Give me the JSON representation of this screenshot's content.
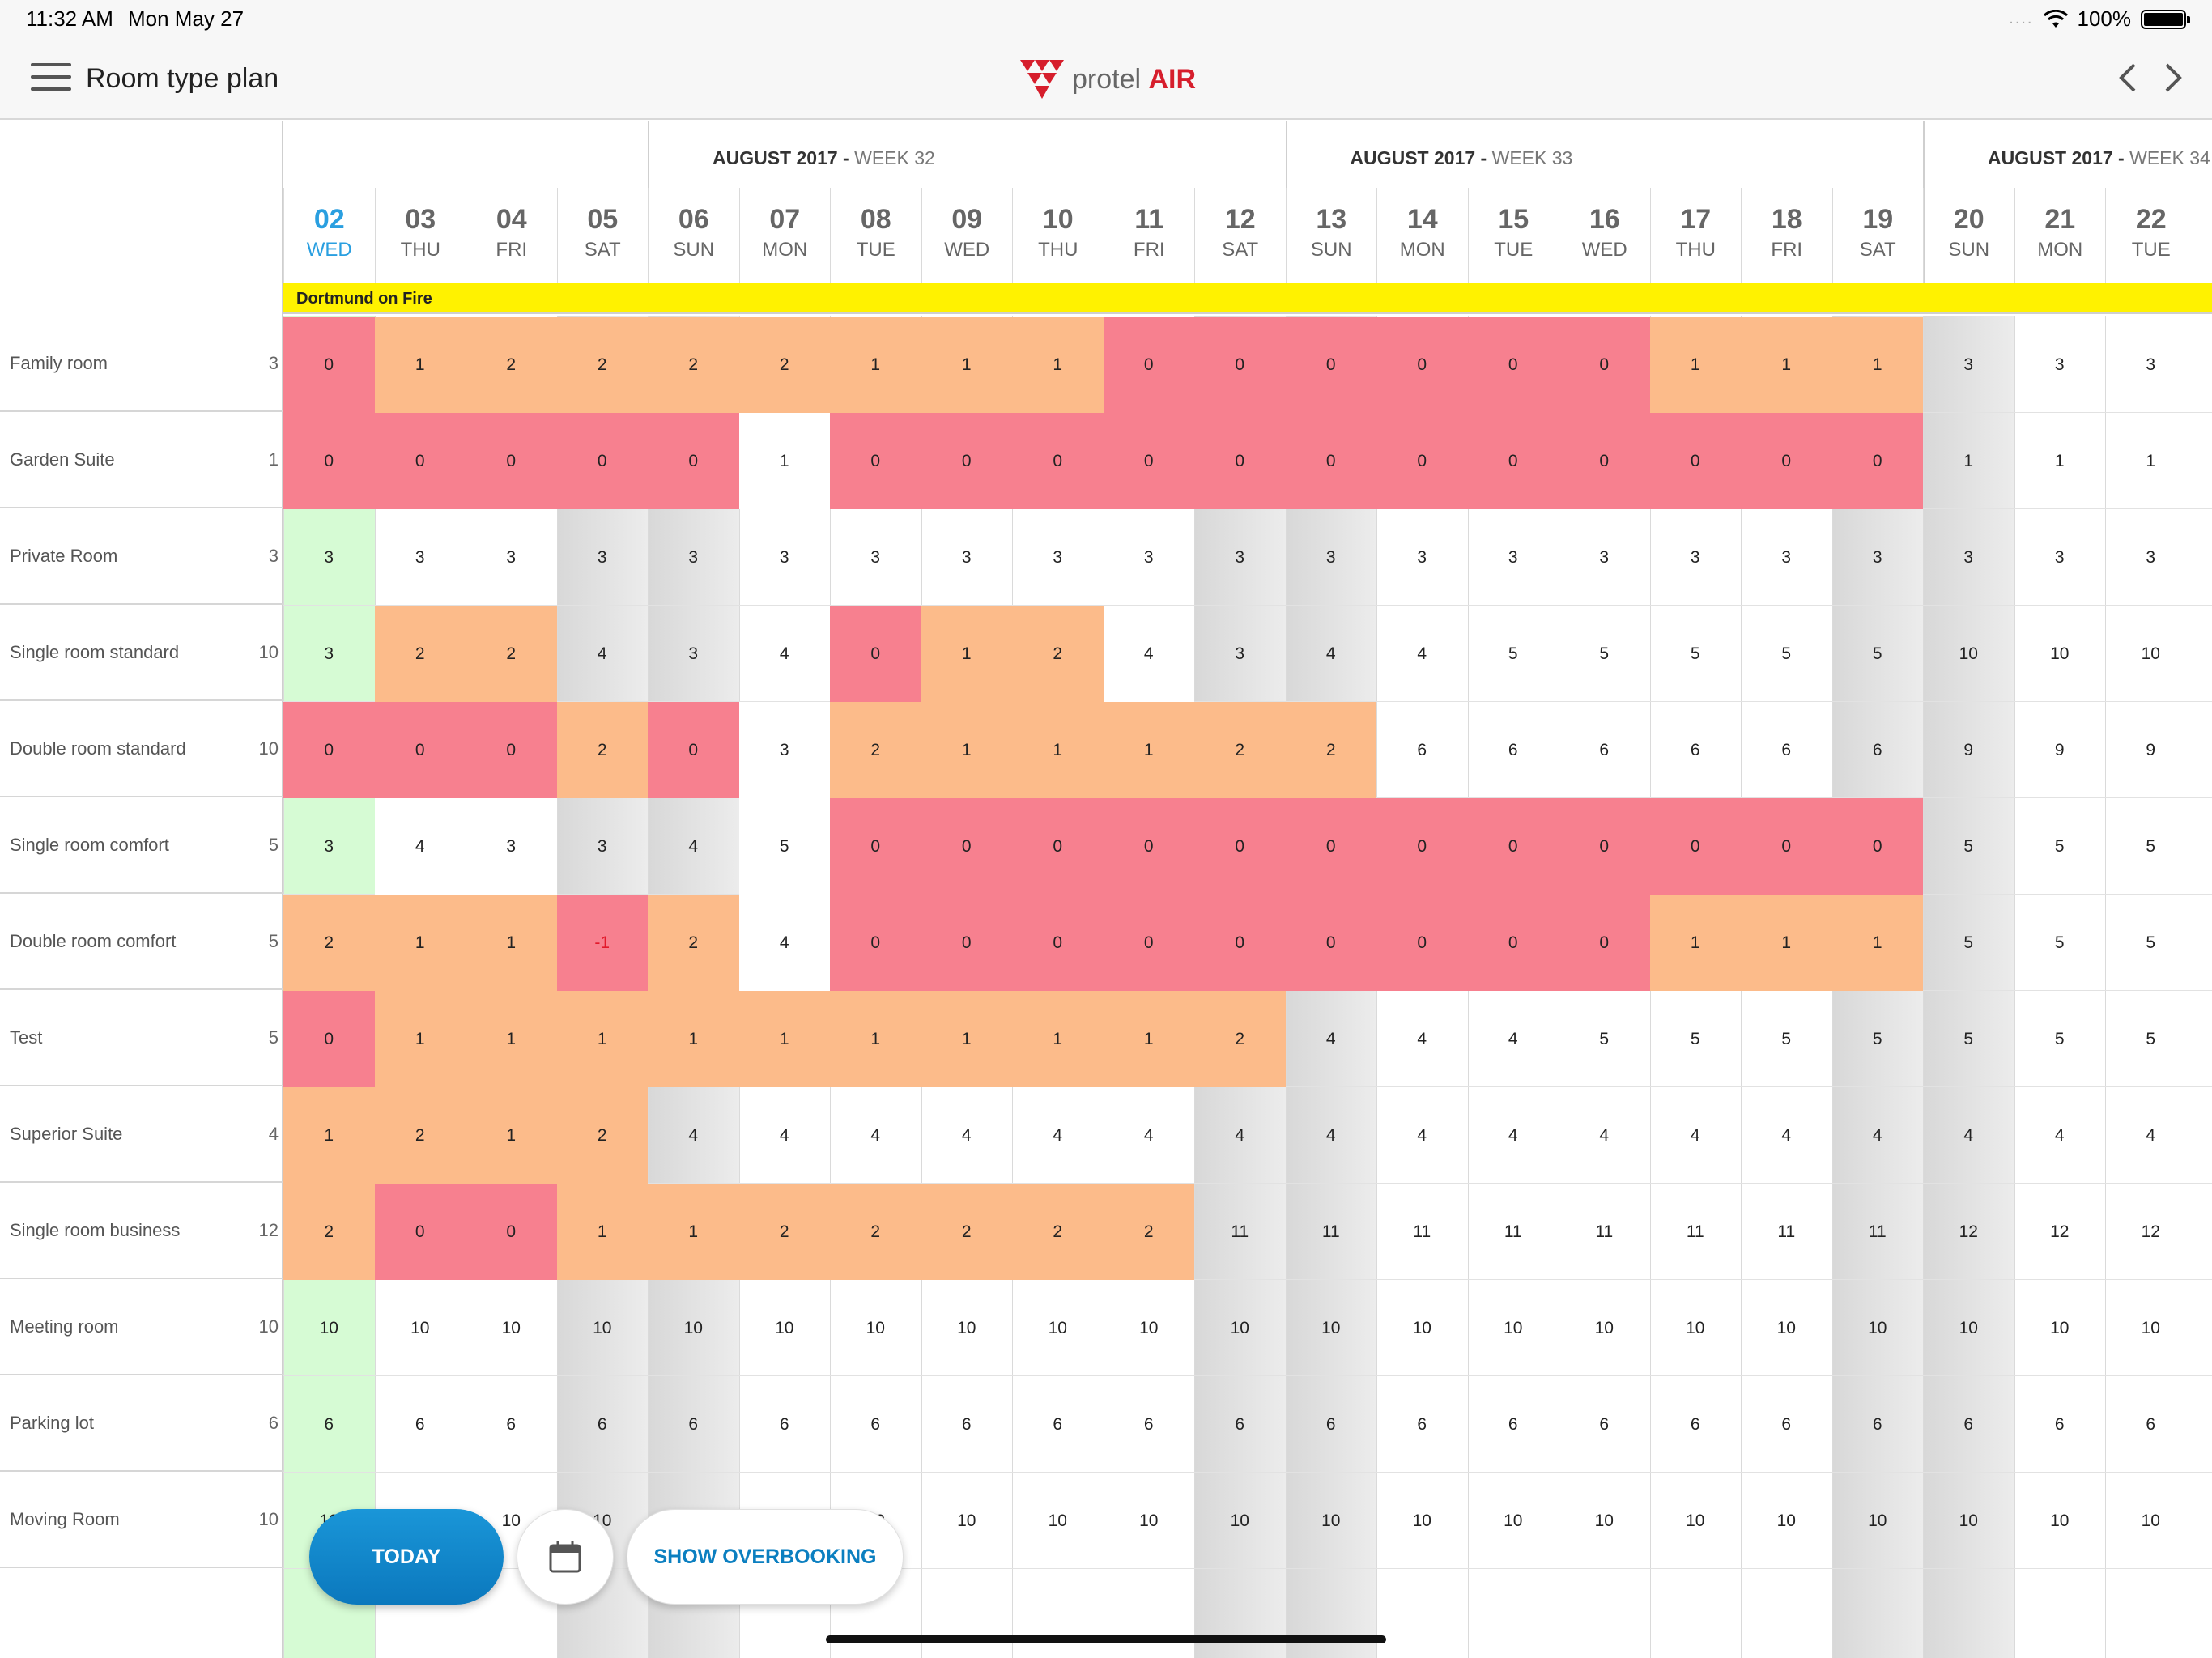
{
  "status_bar": {
    "time": "11:32 AM",
    "date": "Mon May 27",
    "dots": "....",
    "battery": "100%"
  },
  "header": {
    "title": "Room type plan",
    "brand_main": "protel ",
    "brand_accent": "AIR"
  },
  "weeks": [
    {
      "label": "AUGUST 2017 - ",
      "week": "WEEK 32"
    },
    {
      "label": "AUGUST 2017 - ",
      "week": "WEEK 33"
    },
    {
      "label": "AUGUST 2017 - ",
      "week": "WEEK 34"
    }
  ],
  "days": [
    {
      "num": "02",
      "dow": "WED"
    },
    {
      "num": "03",
      "dow": "THU"
    },
    {
      "num": "04",
      "dow": "FRI"
    },
    {
      "num": "05",
      "dow": "SAT"
    },
    {
      "num": "06",
      "dow": "SUN"
    },
    {
      "num": "07",
      "dow": "MON"
    },
    {
      "num": "08",
      "dow": "TUE"
    },
    {
      "num": "09",
      "dow": "WED"
    },
    {
      "num": "10",
      "dow": "THU"
    },
    {
      "num": "11",
      "dow": "FRI"
    },
    {
      "num": "12",
      "dow": "SAT"
    },
    {
      "num": "13",
      "dow": "SUN"
    },
    {
      "num": "14",
      "dow": "MON"
    },
    {
      "num": "15",
      "dow": "TUE"
    },
    {
      "num": "16",
      "dow": "WED"
    },
    {
      "num": "17",
      "dow": "THU"
    },
    {
      "num": "18",
      "dow": "FRI"
    },
    {
      "num": "19",
      "dow": "SAT"
    },
    {
      "num": "20",
      "dow": "SUN"
    },
    {
      "num": "21",
      "dow": "MON"
    },
    {
      "num": "22",
      "dow": "TUE"
    }
  ],
  "event": "Dortmund on Fire",
  "rooms": [
    {
      "name": "Family room",
      "count": "3",
      "values": [
        "0",
        "1",
        "2",
        "2",
        "2",
        "2",
        "1",
        "1",
        "1",
        "0",
        "0",
        "0",
        "0",
        "0",
        "0",
        "1",
        "1",
        "1",
        "3",
        "3",
        "3"
      ],
      "status": [
        "r",
        "o",
        "o",
        "o",
        "o",
        "o",
        "o",
        "o",
        "o",
        "r",
        "r",
        "r",
        "r",
        "r",
        "r",
        "o",
        "o",
        "o",
        "",
        "",
        ""
      ]
    },
    {
      "name": "Garden Suite",
      "count": "1",
      "values": [
        "0",
        "0",
        "0",
        "0",
        "0",
        "1",
        "0",
        "0",
        "0",
        "0",
        "0",
        "0",
        "0",
        "0",
        "0",
        "0",
        "0",
        "0",
        "1",
        "1",
        "1"
      ],
      "status": [
        "r",
        "r",
        "r",
        "r",
        "r",
        "w",
        "r",
        "r",
        "r",
        "r",
        "r",
        "r",
        "r",
        "r",
        "r",
        "r",
        "r",
        "r",
        "",
        "",
        ""
      ]
    },
    {
      "name": "Private Room",
      "count": "3",
      "values": [
        "3",
        "3",
        "3",
        "3",
        "3",
        "3",
        "3",
        "3",
        "3",
        "3",
        "3",
        "3",
        "3",
        "3",
        "3",
        "3",
        "3",
        "3",
        "3",
        "3",
        "3"
      ],
      "status": [
        "",
        "",
        "",
        "",
        "",
        "",
        "",
        "",
        "",
        "",
        "",
        "",
        "",
        "",
        "",
        "",
        "",
        "",
        "",
        "",
        ""
      ]
    },
    {
      "name": "Single room standard",
      "count": "10",
      "values": [
        "3",
        "2",
        "2",
        "4",
        "3",
        "4",
        "0",
        "1",
        "2",
        "4",
        "3",
        "4",
        "4",
        "5",
        "5",
        "5",
        "5",
        "5",
        "10",
        "10",
        "10"
      ],
      "status": [
        "",
        "o",
        "o",
        "",
        "",
        "",
        "r",
        "o",
        "o",
        "w",
        "",
        "",
        "",
        "",
        "",
        "",
        "",
        "",
        "",
        "",
        ""
      ]
    },
    {
      "name": "Double room standard",
      "count": "10",
      "values": [
        "0",
        "0",
        "0",
        "2",
        "0",
        "3",
        "2",
        "1",
        "1",
        "1",
        "2",
        "2",
        "6",
        "6",
        "6",
        "6",
        "6",
        "6",
        "9",
        "9",
        "9"
      ],
      "status": [
        "r",
        "r",
        "r",
        "o",
        "r",
        "w",
        "o",
        "o",
        "o",
        "o",
        "o",
        "o",
        "",
        "",
        "",
        "",
        "",
        "",
        "",
        "",
        ""
      ]
    },
    {
      "name": "Single room comfort",
      "count": "5",
      "values": [
        "3",
        "4",
        "3",
        "3",
        "4",
        "5",
        "0",
        "0",
        "0",
        "0",
        "0",
        "0",
        "0",
        "0",
        "0",
        "0",
        "0",
        "0",
        "5",
        "5",
        "5"
      ],
      "status": [
        "",
        "w",
        "w",
        "",
        "",
        "w",
        "r",
        "r",
        "r",
        "r",
        "r",
        "r",
        "r",
        "r",
        "r",
        "r",
        "r",
        "r",
        "",
        "",
        ""
      ]
    },
    {
      "name": "Double room comfort",
      "count": "5",
      "values": [
        "2",
        "1",
        "1",
        "-1",
        "2",
        "4",
        "0",
        "0",
        "0",
        "0",
        "0",
        "0",
        "0",
        "0",
        "0",
        "1",
        "1",
        "1",
        "5",
        "5",
        "5"
      ],
      "status": [
        "o",
        "o",
        "o",
        "rn",
        "o",
        "w",
        "r",
        "r",
        "r",
        "r",
        "r",
        "r",
        "r",
        "r",
        "r",
        "o",
        "o",
        "o",
        "",
        "",
        ""
      ]
    },
    {
      "name": "Test",
      "count": "5",
      "values": [
        "0",
        "1",
        "1",
        "1",
        "1",
        "1",
        "1",
        "1",
        "1",
        "1",
        "2",
        "4",
        "4",
        "4",
        "5",
        "5",
        "5",
        "5",
        "5",
        "5",
        "5"
      ],
      "status": [
        "r",
        "o",
        "o",
        "o",
        "o",
        "o",
        "o",
        "o",
        "o",
        "o",
        "o",
        "",
        "",
        "",
        "",
        "",
        "",
        "",
        "",
        "",
        ""
      ]
    },
    {
      "name": "Superior Suite",
      "count": "4",
      "values": [
        "1",
        "2",
        "1",
        "2",
        "4",
        "4",
        "4",
        "4",
        "4",
        "4",
        "4",
        "4",
        "4",
        "4",
        "4",
        "4",
        "4",
        "4",
        "4",
        "4",
        "4"
      ],
      "status": [
        "o",
        "o",
        "o",
        "o",
        "",
        "",
        "",
        "",
        "",
        "",
        "",
        "",
        "",
        "",
        "",
        "",
        "",
        "",
        "",
        "",
        ""
      ]
    },
    {
      "name": "Single room business",
      "count": "12",
      "values": [
        "2",
        "0",
        "0",
        "1",
        "1",
        "2",
        "2",
        "2",
        "2",
        "2",
        "11",
        "11",
        "11",
        "11",
        "11",
        "11",
        "11",
        "11",
        "12",
        "12",
        "12"
      ],
      "status": [
        "o",
        "r",
        "r",
        "o",
        "o",
        "o",
        "o",
        "o",
        "o",
        "o",
        "",
        "",
        "",
        "",
        "",
        "",
        "",
        "",
        "",
        "",
        ""
      ]
    },
    {
      "name": "Meeting room",
      "count": "10",
      "values": [
        "10",
        "10",
        "10",
        "10",
        "10",
        "10",
        "10",
        "10",
        "10",
        "10",
        "10",
        "10",
        "10",
        "10",
        "10",
        "10",
        "10",
        "10",
        "10",
        "10",
        "10"
      ],
      "status": [
        "",
        "",
        "",
        "",
        "",
        "",
        "",
        "",
        "",
        "",
        "",
        "",
        "",
        "",
        "",
        "",
        "",
        "",
        "",
        "",
        ""
      ]
    },
    {
      "name": "Parking lot",
      "count": "6",
      "values": [
        "6",
        "6",
        "6",
        "6",
        "6",
        "6",
        "6",
        "6",
        "6",
        "6",
        "6",
        "6",
        "6",
        "6",
        "6",
        "6",
        "6",
        "6",
        "6",
        "6",
        "6"
      ],
      "status": [
        "",
        "",
        "",
        "",
        "",
        "",
        "",
        "",
        "",
        "",
        "",
        "",
        "",
        "",
        "",
        "",
        "",
        "",
        "",
        "",
        ""
      ]
    },
    {
      "name": "Moving Room",
      "count": "10",
      "values": [
        "10",
        "10",
        "10",
        "10",
        "10",
        "10",
        "10",
        "10",
        "10",
        "10",
        "10",
        "10",
        "10",
        "10",
        "10",
        "10",
        "10",
        "10",
        "10",
        "10",
        "10"
      ],
      "status": [
        "",
        "",
        "",
        "",
        "",
        "",
        "",
        "",
        "",
        "",
        "",
        "",
        "",
        "",
        "",
        "",
        "",
        "",
        "",
        "",
        ""
      ]
    }
  ],
  "buttons": {
    "today": "TODAY",
    "show_overbooking": "SHOW OVERBOOKING"
  },
  "colors": {
    "today_accent": "#2a9fe0",
    "unavailable": "#f7808f",
    "low": "#fcbb8a",
    "event": "#fff200",
    "today_column": "#d6fbd4"
  },
  "icons": {
    "menu": "hamburger-icon",
    "prev": "chevron-left-icon",
    "next": "chevron-right-icon",
    "calendar": "calendar-icon",
    "wifi": "wifi-icon",
    "battery": "battery-icon"
  }
}
